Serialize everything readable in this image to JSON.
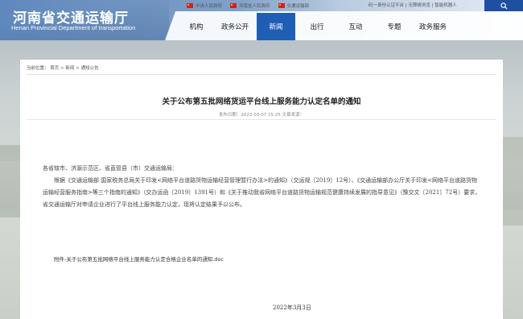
{
  "header": {
    "site_title": "河南省交通运输厅",
    "site_subtitle": "Henan Provincial Department of transportation",
    "top_links": [
      "中央人民政府",
      "河南省人民政府",
      "交通运输部"
    ],
    "right_links": "码一身份认证平台 | 无障碍浏览 | 智能机器人",
    "search_icon": "search-icon",
    "nav": [
      "机构",
      "政务公开",
      "新闻",
      "出行",
      "互动",
      "专题",
      "政务服务"
    ],
    "nav_active": "新闻",
    "colors": {
      "nav_active": "#1e5fb5",
      "search_button": "#1f4fa0",
      "flag": "#d8201d"
    }
  },
  "breadcrumb": "当前位置： 首页 > 新闻 > 通知公告",
  "article": {
    "title": "关于公布第五批网络货运平台线上服务能力认定名单的通知",
    "meta": "发布日期：2022-03-07 15:25  文章来源：",
    "salutation": "各省辖市、济源示范区、省直管县（市）交通运输局：",
    "paragraph": "根据《交通运输部 国家税务总局关于印发<网络平台道路货物运输经营管理暂行办法>的通知》（交运规〔2019〕12号）、《交通运输部办公厅关于印发<网络平台道路货物运输经营服务指南>等三个指南的通知》（交办运函〔2019〕1391号）和《关于推动我省网络平台道路货物运输规范健康持续发展的指导意见》（豫交文〔2021〕72号）要求，省交通运输厅对申请企业进行了平台线上服务能力认定，现将认定结果予以公布。",
    "attachment": "附件-关于公布第五批网络平台线上服务能力认定合格企业名单的通知.doc",
    "date": "2022年3月3日"
  }
}
